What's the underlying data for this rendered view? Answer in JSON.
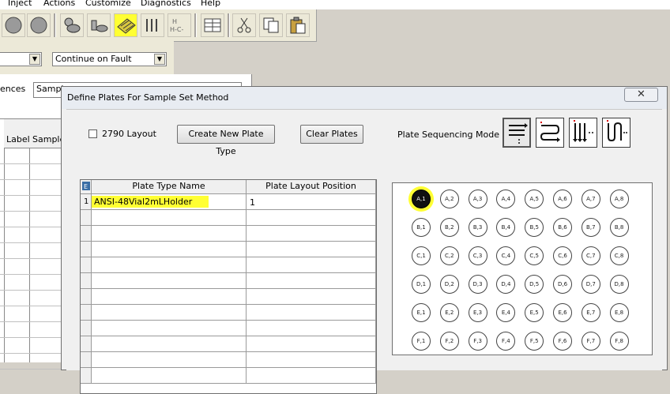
{
  "menu": {
    "items": [
      "Inject",
      "Actions",
      "Customize",
      "Diagnostics",
      "Help"
    ]
  },
  "behind": {
    "fault_combo": "Continue on Fault",
    "label_partial": "ences",
    "field_partial": "Sampl",
    "col_label": "Label",
    "col_sample": "Sample"
  },
  "dialog": {
    "title": "Define Plates For Sample Set Method",
    "close_glyph": "✕",
    "layout_2790": "2790 Layout",
    "create_button": "Create New Plate Type",
    "clear_button": "Clear Plates",
    "sequencing_label": "Plate Sequencing Mode",
    "grid": {
      "corner_icon": "grid-corner-icon",
      "headers": [
        "Plate Type Name",
        "Plate Layout Position"
      ],
      "rows": [
        {
          "num": "1",
          "name": "ANSI-48Vial2mLHolder",
          "position": "1"
        }
      ]
    },
    "plate": {
      "rows": [
        "A",
        "B",
        "C",
        "D",
        "E",
        "F"
      ],
      "cols": [
        "1",
        "2",
        "3",
        "4",
        "5",
        "6",
        "7",
        "8"
      ],
      "selected": "A,1"
    },
    "highlight_color": "#ffff33"
  }
}
